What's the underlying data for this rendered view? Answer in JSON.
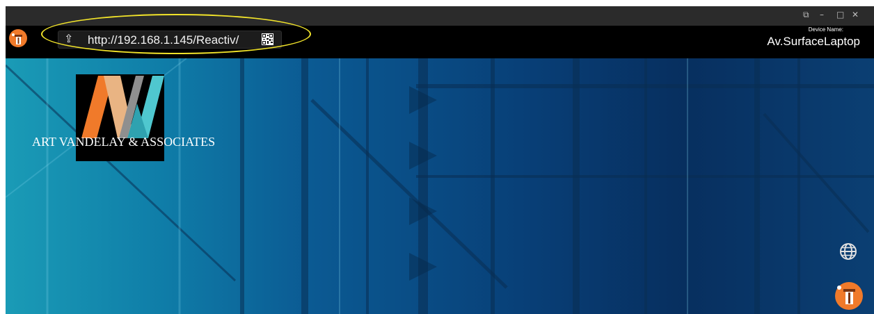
{
  "toolbar": {
    "url": "http://192.168.1.145/Reactiv/",
    "device_label": "Device Name:",
    "device_value": "Av.SurfaceLaptop"
  },
  "titlebar": {
    "controls": [
      "popout-icon",
      "minimize-icon",
      "maximize-icon",
      "close-icon"
    ]
  },
  "content": {
    "company_name": "ART VANDELAY & ASSOCIATES"
  },
  "colors": {
    "accent_orange": "#f07a2a",
    "highlight_yellow": "#f2e42a",
    "logo_teal": "#4fc7cf",
    "logo_peach": "#e9b483"
  },
  "icons": [
    "app-logo-icon",
    "share-icon",
    "qr-code-icon",
    "globe-icon",
    "corner-app-logo-icon"
  ]
}
